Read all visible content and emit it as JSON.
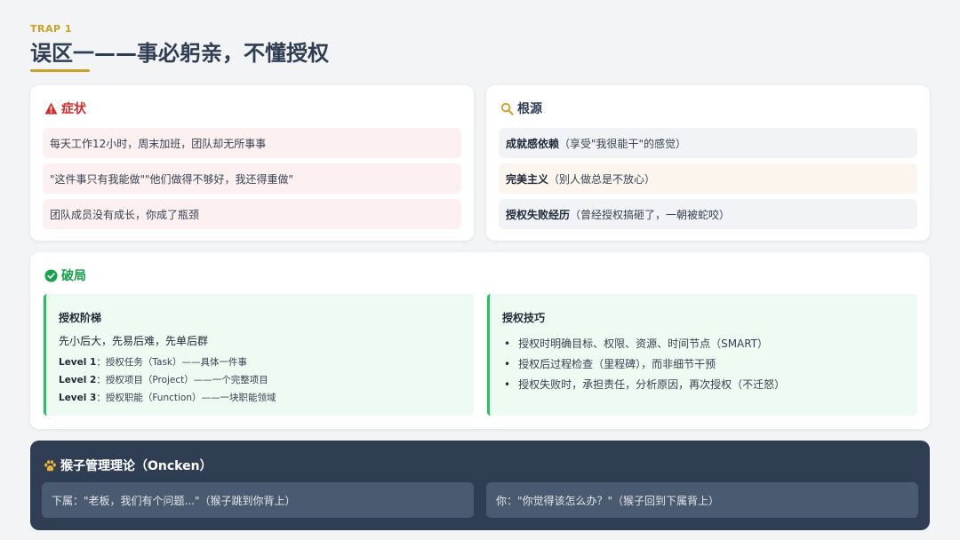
{
  "header": {
    "eyebrow": "TRAP 1",
    "title": "误区一——事必躬亲，不懂授权"
  },
  "symptoms": {
    "title": "症状",
    "icon": "warning-icon",
    "items": [
      "每天工作12小时，周末加班，团队却无所事事",
      "\"这件事只有我能做\"\"他们做得不够好，我还得重做\"",
      "团队成员没有成长，你成了瓶颈"
    ]
  },
  "roots": {
    "title": "根源",
    "icon": "search-icon",
    "items": [
      {
        "bold": "成就感依赖",
        "rest": "（享受\"我很能干\"的感觉）"
      },
      {
        "bold": "完美主义",
        "rest": "（别人做总是不放心）"
      },
      {
        "bold": "授权失败经历",
        "rest": "（曾经授权搞砸了，一朝被蛇咬）"
      }
    ]
  },
  "solution": {
    "title": "破局",
    "icon": "check-circle-icon",
    "ladder": {
      "title": "授权阶梯",
      "lead": "先小后大，先易后难，先单后群",
      "levels": [
        {
          "label": "Level 1",
          "text": "：授权任务（Task）——具体一件事"
        },
        {
          "label": "Level 2",
          "text": "：授权项目（Project）——一个完整项目"
        },
        {
          "label": "Level 3",
          "text": "：授权职能（Function）——一块职能领域"
        }
      ]
    },
    "tips": {
      "title": "授权技巧",
      "items": [
        "授权时明确目标、权限、资源、时间节点（SMART）",
        "授权后过程检查（里程碑），而非细节干预",
        "授权失败时，承担责任，分析原因，再次授权（不迁怒）"
      ]
    }
  },
  "monkey": {
    "title": "猴子管理理论（Oncken）",
    "icon": "paw-icon",
    "left": "下属：\"老板，我们有个问题...\"（猴子跳到你背上）",
    "right": "你：\"你觉得该怎么办？\"（猴子回到下属背上）"
  },
  "colors": {
    "gold": "#c9a227",
    "navy": "#2f3e53",
    "red": "#d42b2b",
    "green": "#22c55e"
  }
}
